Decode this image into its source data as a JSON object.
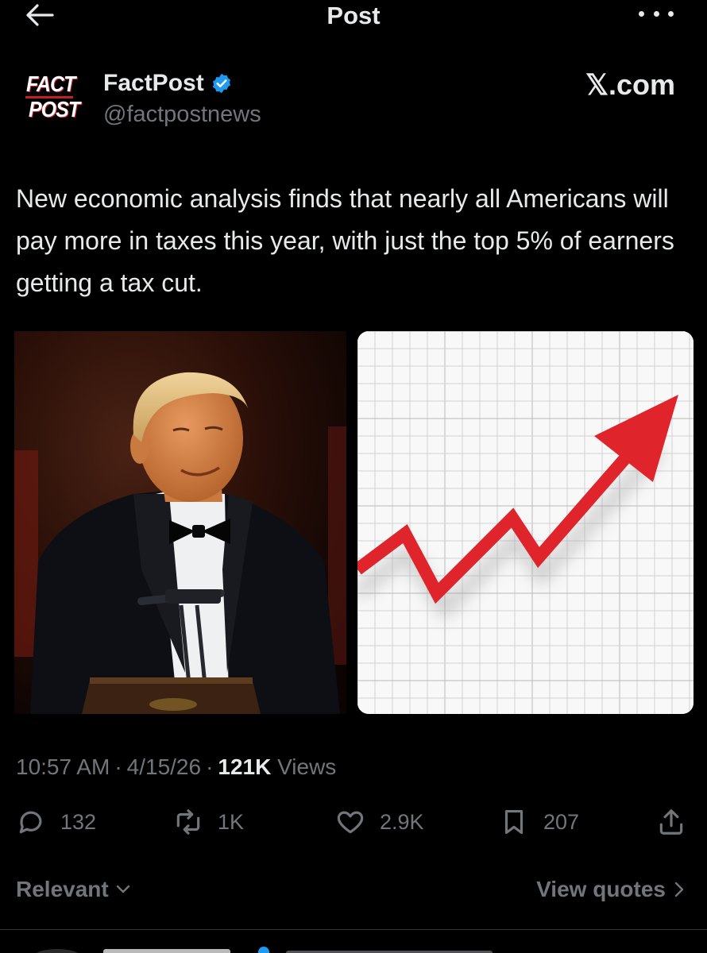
{
  "header": {
    "title": "Post",
    "back_icon": "arrow-left-icon",
    "more_icon": "more-horizontal-icon"
  },
  "author": {
    "logo_line1": "FACT",
    "logo_line2": "POST",
    "display_name": "FactPost",
    "handle": "@factpostnews",
    "verified": true,
    "brand": "𝕏.com"
  },
  "post": {
    "text": "New economic analysis finds that nearly all Americans will pay more in taxes this year, with just the top 5% of earners getting a tax cut."
  },
  "media": {
    "left_image": "photo-man-in-tuxedo-at-podium",
    "right_image": "red-upward-arrow-on-grid"
  },
  "meta": {
    "time": "10:57 AM",
    "date": "4/15/26",
    "views_count": "121K",
    "views_label": "Views"
  },
  "actions": {
    "replies": "132",
    "reposts": "1K",
    "likes": "2.9K",
    "bookmarks": "207"
  },
  "footer": {
    "sort_label": "Relevant",
    "quotes_label": "View quotes"
  },
  "colors": {
    "background": "#000000",
    "text_primary": "#e7e9ea",
    "text_secondary": "#71767b",
    "verified_blue": "#1d9bf0",
    "arrow_red": "#e0242c",
    "logo_red": "#c81d25"
  }
}
